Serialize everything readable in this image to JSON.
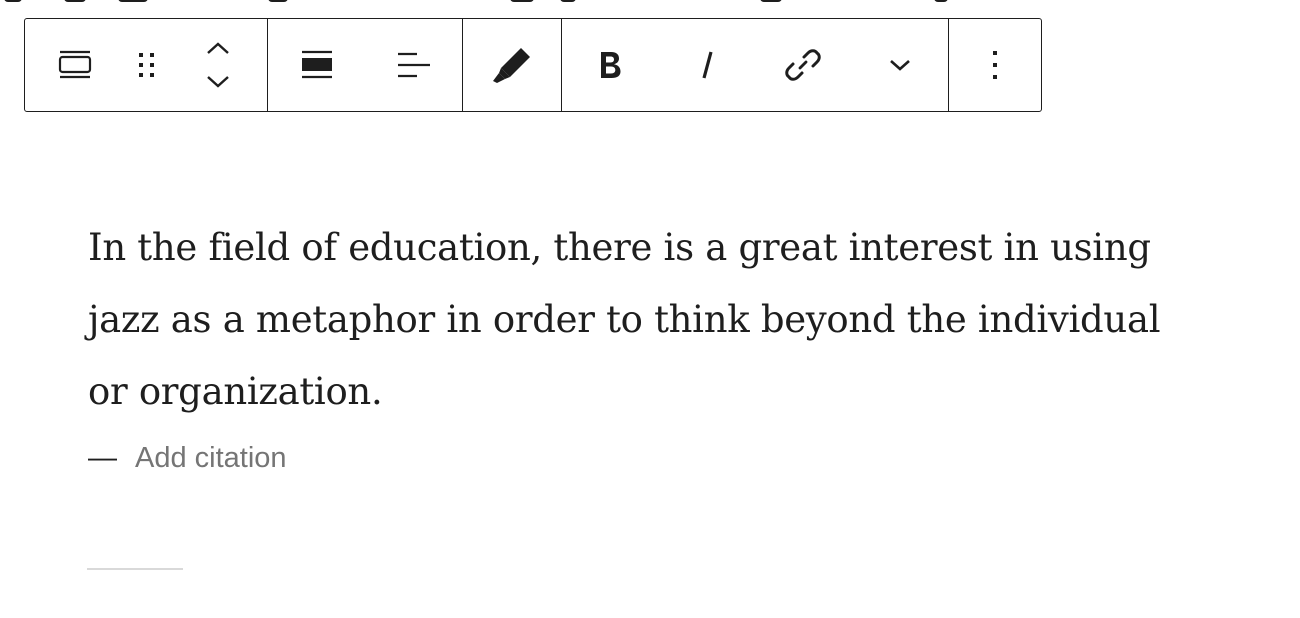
{
  "toolbar": {
    "buttons": [
      {
        "group": "block",
        "icon": "quote-transform-icon"
      },
      {
        "group": "block",
        "icon": "drag-handle-icon"
      },
      {
        "group": "block",
        "icon": "move-up-icon"
      },
      {
        "group": "block",
        "icon": "move-down-icon"
      },
      {
        "group": "alignment",
        "icon": "align-wide-icon"
      },
      {
        "group": "alignment",
        "icon": "text-align-left-icon"
      },
      {
        "group": "style",
        "icon": "highlighter-icon"
      },
      {
        "group": "format",
        "icon": "bold-icon"
      },
      {
        "group": "format",
        "icon": "italic-icon"
      },
      {
        "group": "format",
        "icon": "link-icon"
      },
      {
        "group": "format",
        "icon": "chevron-down-icon"
      },
      {
        "group": "options",
        "icon": "more-vertical-icon"
      }
    ]
  },
  "quote": {
    "text": "In the field of education, there is a great interest in using jazz as a metaphor in order to think beyond the individual or organization.",
    "citation_dash": "—",
    "citation_placeholder": "Add citation"
  },
  "colors": {
    "text": "#1e1e1e",
    "placeholder": "#757575",
    "divider": "#d9d9d9"
  }
}
